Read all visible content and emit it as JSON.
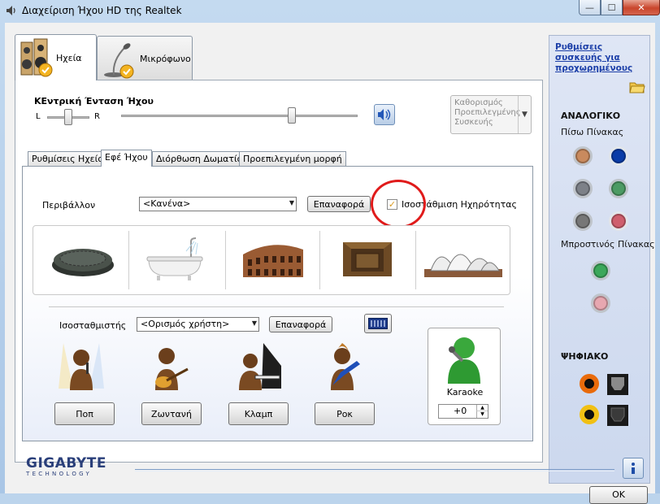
{
  "window": {
    "title": "Διαχείριση Ήχου HD της Realtek"
  },
  "device_tabs": [
    {
      "label": "Ηχεία",
      "icon": "speakers-icon",
      "active": true
    },
    {
      "label": "Μικρόφωνο",
      "icon": "microphone-icon",
      "active": false
    }
  ],
  "volume": {
    "title": "ΚΕντρική Ένταση Ήχου",
    "left_label": "L",
    "right_label": "R",
    "balance": 0.5,
    "level": 0.72
  },
  "default_device": {
    "label": "Καθορισμός Προεπιλεγμένης Συσκευής"
  },
  "sub_tabs": [
    {
      "label": "Ρυθμίσεις Ηχείου"
    },
    {
      "label": "Εφέ Ήχου"
    },
    {
      "label": "Διόρθωση Δωματίου"
    },
    {
      "label": "Προεπιλεγμένη μορφή"
    }
  ],
  "environment": {
    "label": "Περιβάλλον",
    "value": "<Κανένα>",
    "reset_label": "Επαναφορά",
    "loudness_label": "Ισοστάθμιση Ηχηρότητας",
    "loudness_checked": true
  },
  "equalizer": {
    "label": "Ισοσταθμιστής",
    "value": "<Ορισμός χρήστη>",
    "reset_label": "Επαναφορά",
    "presets": [
      {
        "label": "Ποπ"
      },
      {
        "label": "Ζωντανή"
      },
      {
        "label": "Κλαμπ"
      },
      {
        "label": "Ροκ"
      }
    ]
  },
  "karaoke": {
    "label": "Karaoke",
    "value": "+0"
  },
  "right_panel": {
    "link": "Ρυθμίσεις συσκευής για προχωρημένους",
    "analog_title": "ΑΝΑΛΟΓΙΚΟ",
    "back_panel": "Πίσω Πίνακας",
    "front_panel": "Μπροστινός Πίνακας",
    "digital_title": "ΨΗΦΙΑΚΟ"
  },
  "brand": {
    "name": "GIGABYTE",
    "tagline": "TECHNOLOGY"
  },
  "ok_label": "OK",
  "colors": {
    "accent": "#1c3fa8",
    "red_annotation": "#e01b1b",
    "jack_orange": "#c98a5e",
    "jack_blue": "#0a3ca8",
    "jack_gray": "#7d8188",
    "jack_green": "#4c9b63",
    "jack_pink": "#cf5f6d",
    "front_green": "#3ca85a",
    "front_pink": "#e7a7b0",
    "spdif_orange": "#e96b0b",
    "spdif_yellow": "#f1c014"
  }
}
